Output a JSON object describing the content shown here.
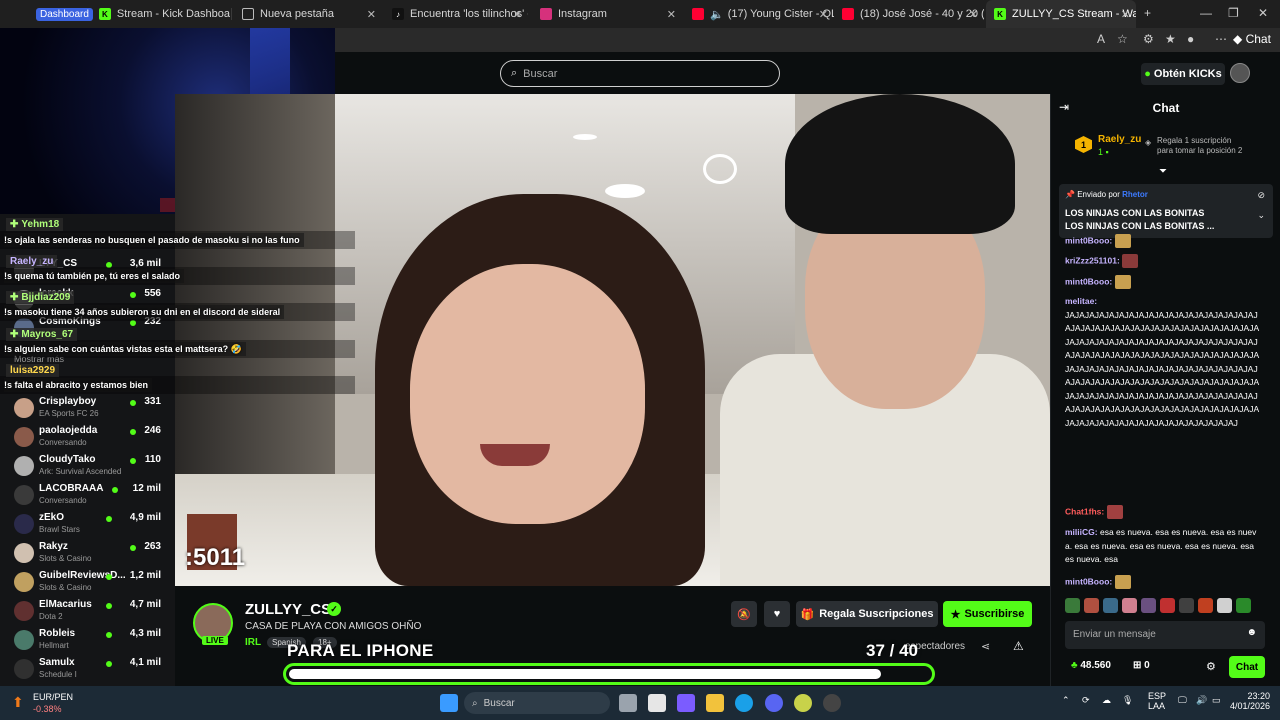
{
  "browser": {
    "tabs": [
      {
        "label": "Stream - Kick Dashboard",
        "badge": "Dashboard"
      },
      {
        "label": "Nueva pestaña"
      },
      {
        "label": "Encuentra 'los tilinchos' en TikTo"
      },
      {
        "label": "Instagram"
      },
      {
        "label": "(17) Young Cister - QLOO*"
      },
      {
        "label": "(18) José José - 40 y 20 (Video"
      },
      {
        "label": "ZULLYY_CS Stream - Watch Live"
      }
    ],
    "toolbar_chat_label": "Chat"
  },
  "header": {
    "search_placeholder": "Buscar",
    "obten_kicks": "Obtén KICKs"
  },
  "overlay_chat": [
    {
      "user": "Yehm18",
      "color": "green",
      "msg": "!s ojala las senderas no busquen el pasado de masoku si no las funo"
    },
    {
      "user": "Raely_zu",
      "color": "purple",
      "msg": "!s quema tú también pe, tú eres el salado"
    },
    {
      "user": "Bjjdiaz209",
      "color": "green",
      "msg": "!s masoku tiene 34 años subieron su dni en el discord de sideral"
    },
    {
      "user": "Mayros_67",
      "color": "green",
      "msg": "!s alguien sabe con cuántas vistas esta el mattsera? 🤣"
    },
    {
      "user": "luisa2929",
      "color": "yellow",
      "msg": "!s falta el abracito y estamos bien"
    }
  ],
  "sidebar": {
    "items": [
      {
        "name": "LYY_CS",
        "views": "3,6 mil",
        "category": ""
      },
      {
        "name": "lcrackk",
        "views": "556",
        "category": ""
      },
      {
        "name": "CosmoKings",
        "views": "232",
        "category": ""
      },
      {
        "name": "Crisplayboy",
        "views": "331",
        "category": "EA Sports FC 26"
      },
      {
        "name": "paolaojedda",
        "views": "246",
        "category": "Conversando"
      },
      {
        "name": "CloudyTako",
        "views": "110",
        "category": "Ark: Survival Ascended"
      },
      {
        "name": "LACOBRAAA",
        "views": "12 mil",
        "category": "Conversando"
      },
      {
        "name": "zEkO",
        "views": "4,9 mil",
        "category": "Brawl Stars"
      },
      {
        "name": "Rakyz",
        "views": "263",
        "category": "Slots & Casino"
      },
      {
        "name": "GuibelReviewsD...",
        "views": "1,2 mil",
        "category": "Slots & Casino"
      },
      {
        "name": "ElMacarius",
        "views": "4,7 mil",
        "category": "Dota 2"
      },
      {
        "name": "Robleis",
        "views": "4,3 mil",
        "category": "Hellmart"
      },
      {
        "name": "Samulx",
        "views": "4,1 mil",
        "category": "Schedule I"
      }
    ],
    "mostrar_mas": "Mostrar más"
  },
  "video": {
    "counter": ":5011"
  },
  "stream": {
    "streamer": "ZULLYY_CS",
    "live": "LIVE",
    "title": "CASA DE PLAYA CON AMIGOS OHÑO",
    "category": "IRL",
    "tags": [
      "Spanish",
      "18+"
    ],
    "gift_btn": "Regala Suscripciones",
    "sub_btn": "Suscribirse",
    "viewers_label": "espectadores",
    "goal_text": "PARA EL IPHONE",
    "goal_count": "37 / 40",
    "goal_progress": 0.925
  },
  "chat": {
    "title": "Chat",
    "top_gifter": {
      "rank": "1",
      "name": "Raely_zu",
      "count": "1",
      "hint_line1": "Regala 1 suscripción",
      "hint_line2": "para tomar la posición 2"
    },
    "pinned": {
      "by_label": "Enviado por",
      "by_user": "Rhetor",
      "line1": "LOS NINJAS CON LAS BONITAS",
      "line2": "LOS NINJAS CON LAS BONITAS ..."
    },
    "messages": [
      {
        "user": "mint0Booo:",
        "color": "#c6b4ff",
        "text": ""
      },
      {
        "user": "kriZzz251101:",
        "color": "#c6b4ff",
        "text": ""
      },
      {
        "user": "mint0Booo:",
        "color": "#c6b4ff",
        "text": ""
      },
      {
        "user": "melitae:",
        "color": "#c6b4ff",
        "text": "JAJAJAJAJAJAJAJAJAJAJAJAJAJAJAJAJAJAJAJAJAJAJAJAJAJAJAJAJAJAJAJAJAJAJAJAJAJAJAJAJAJAJAJAJAJAJAJAJAJAJAJAJAJAJAJAJAJAJAJAJAJAJAJAJAJAJAJAJAJAJAJAJAJAJAJAJAJAJAJAJAJAJAJAJAJAJAJAJAJAJAJAJAJAJAJAJAJAJAJAJAJAJAJAJAJAJAJAJAJAJAJAJAJAJAJAJAJAJAJAJAJAJAJAJAJAJAJAJAJAJAJAJAJAJAJAJAJAJAJAJAJAJAJAJAJAJAJAJAJAJAJAJAJAJAJAJAJAJAJAJAJAJAJAJAJAJAJAJAJAJAJAJAJ"
      },
      {
        "user": "Chat1fhs:",
        "color": "#ff5c5c",
        "text": ""
      },
      {
        "user": "miliiCG:",
        "color": "#c6b4ff",
        "text": "esa es nueva. esa es nueva. esa es nueva. esa es nueva. esa es nueva. esa es nueva. esa es nueva. esa"
      },
      {
        "user": "mint0Booo:",
        "color": "#c6b4ff",
        "text": ""
      }
    ],
    "input_placeholder": "Enviar un mensaje",
    "points": "48.560",
    "gift_count": "0",
    "send_btn": "Chat"
  },
  "taskbar": {
    "ticker_symbol": "EUR/PEN",
    "ticker_change": "-0.38%",
    "search": "Buscar",
    "lang_top": "ESP",
    "lang_bottom": "LAA",
    "time": "23:20",
    "date": "4/01/2026"
  }
}
